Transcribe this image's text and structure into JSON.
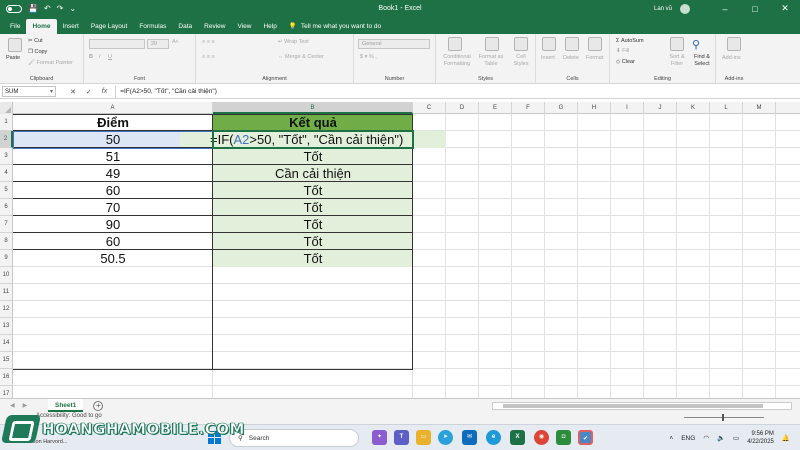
{
  "titlebar": {
    "title": "Book1  -  Excel",
    "user": "Lan vũ",
    "minimize": "–",
    "maximize": "□",
    "close": "✕",
    "icons": [
      "autosave-toggle",
      "save-icon",
      "undo-icon",
      "redo-icon",
      "customize-icon"
    ]
  },
  "menu": {
    "tabs": [
      "File",
      "Home",
      "Insert",
      "Page Layout",
      "Formulas",
      "Data",
      "Review",
      "View",
      "Help"
    ],
    "active": "Home",
    "tell_me": "Tell me what you want to do"
  },
  "ribbon": {
    "clipboard": {
      "label": "Clipboard",
      "paste": "Paste",
      "cut": "Cut",
      "copy": "Copy",
      "format_painter": "Format Painter"
    },
    "font": {
      "label": "Font",
      "size": "20"
    },
    "alignment": {
      "label": "Alignment",
      "wrap": "Wrap Text",
      "merge": "Merge & Center"
    },
    "number": {
      "label": "Number",
      "format": "General"
    },
    "styles": {
      "label": "Styles",
      "conditional": "Conditional Formatting",
      "format_table": "Format as Table",
      "cell_styles": "Cell Styles"
    },
    "cells": {
      "label": "Cells",
      "insert": "Insert",
      "delete": "Delete",
      "format": "Format"
    },
    "editing": {
      "label": "Editing",
      "autosum": "AutoSum",
      "fill": "Fill",
      "clear": "Clear",
      "sort": "Sort & Filter",
      "find": "Find & Select"
    },
    "addins": {
      "label": "Add-ins",
      "addins": "Add-ins"
    }
  },
  "formula_bar": {
    "name_box": "SUM",
    "cancel": "✕",
    "enter": "✓",
    "fx": "fx",
    "formula": "=IF(A2>50, \"Tốt\", \"Cần cải thiện\")"
  },
  "grid": {
    "columns": [
      "A",
      "B",
      "C",
      "D",
      "E",
      "F",
      "G",
      "H",
      "I",
      "J",
      "K",
      "L",
      "M"
    ],
    "rows": [
      "1",
      "2",
      "3",
      "4",
      "5",
      "6",
      "7",
      "8",
      "9",
      "10",
      "11",
      "12",
      "13",
      "14",
      "15",
      "16",
      "17"
    ],
    "header_a": "Điểm",
    "header_b": "Kết quả",
    "editing_formula_prefix": "=IF(",
    "editing_formula_ref": "A2",
    "editing_formula_suffix": ">50, \"Tốt\", \"Cần cải thiện\")",
    "scores": [
      "50",
      "51",
      "49",
      "60",
      "70",
      "90",
      "60",
      "50.5"
    ],
    "results": [
      "",
      "Tốt",
      "Cần cải thiện",
      "Tốt",
      "Tốt",
      "Tốt",
      "Tốt",
      "Tốt"
    ],
    "colors": {
      "green_light": "#e2efda",
      "green_dark": "#70ad47",
      "ref_blue": "#4472c4"
    }
  },
  "sheets": {
    "tabs": [
      "Sheet1"
    ],
    "add": "+"
  },
  "status": {
    "text": "Accessibility: Good to go"
  },
  "taskbar": {
    "search": "Search",
    "sub_text": "Jason Harvord...",
    "watermark": "HOANGHAMOBILE.COM",
    "lang": "ENG",
    "time": "9:56 PM",
    "date": "4/22/2025"
  }
}
